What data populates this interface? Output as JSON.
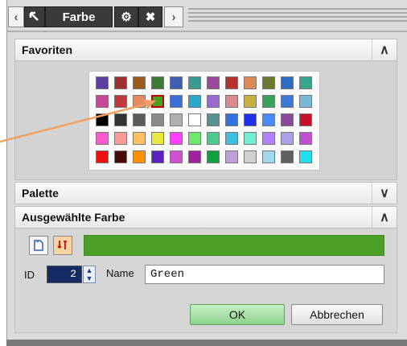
{
  "toolbar": {
    "title": "Farbe",
    "back_icon": "chevron-left-icon",
    "forward_icon": "chevron-right-icon",
    "arrow_icon": "pointer-arrow-icon",
    "settings_icon": "gear-icon",
    "close_icon": "close-icon"
  },
  "favorites": {
    "label": "Favoriten",
    "chevron": "chevron-up-icon",
    "swatches": [
      [
        "#5b3ea3",
        "#a03030",
        "#9a5a20",
        "#3e7a35",
        "#3f5fb3",
        "#3a9a8f",
        "#9a4a9a",
        "#b83030",
        "#d98a55",
        "#6b7a2a",
        "#2e6bc2",
        "#39a58a"
      ],
      [
        "#c5479a",
        "#c03a3a",
        "#e88a60",
        "#4aa026",
        "#3b6fd6",
        "#2aa8c8",
        "#9a6ad0",
        "#d98a8a",
        "#c8b040",
        "#36a25a",
        "#3a7ad6",
        "#7ab8d8"
      ],
      [
        "#000000",
        "#333333",
        "#5a5a5a",
        "#8a8a8a",
        "#b0b0b0",
        "#ffffff",
        "#5a9090",
        "#3070e0",
        "#1e30e8",
        "#4a8aff",
        "#8a4a9a",
        "#c8102a"
      ],
      [
        "#ff5ad0",
        "#ff9a9a",
        "#ffc060",
        "#e8e840",
        "#ff40ff",
        "#70e870",
        "#50c890",
        "#40c0e0",
        "#70f0d0",
        "#b080ff",
        "#b0a0e8",
        "#c050d0"
      ],
      [
        "#ee1010",
        "#4a0a0a",
        "#ff9000",
        "#5a20c0",
        "#d050d0",
        "#a020a0",
        "#10a040",
        "#c0a0d8",
        "#d0d0d0",
        "#a0d8f0",
        "#606060",
        "#20e0f0"
      ]
    ],
    "selected_row": 1,
    "selected_col": 3
  },
  "palette": {
    "label": "Palette",
    "chevron": "chevron-down-icon"
  },
  "selected_color": {
    "label": "Ausgewählte Farbe",
    "chevron": "chevron-up-icon",
    "color": "#4aa026",
    "id_label": "ID",
    "id_value": "2",
    "name_label": "Name",
    "name_value": "Green",
    "inherit_icon": "inherit-color-icon",
    "pick_icon": "color-picker-icon"
  },
  "buttons": {
    "ok": "OK",
    "cancel": "Abbrechen"
  }
}
